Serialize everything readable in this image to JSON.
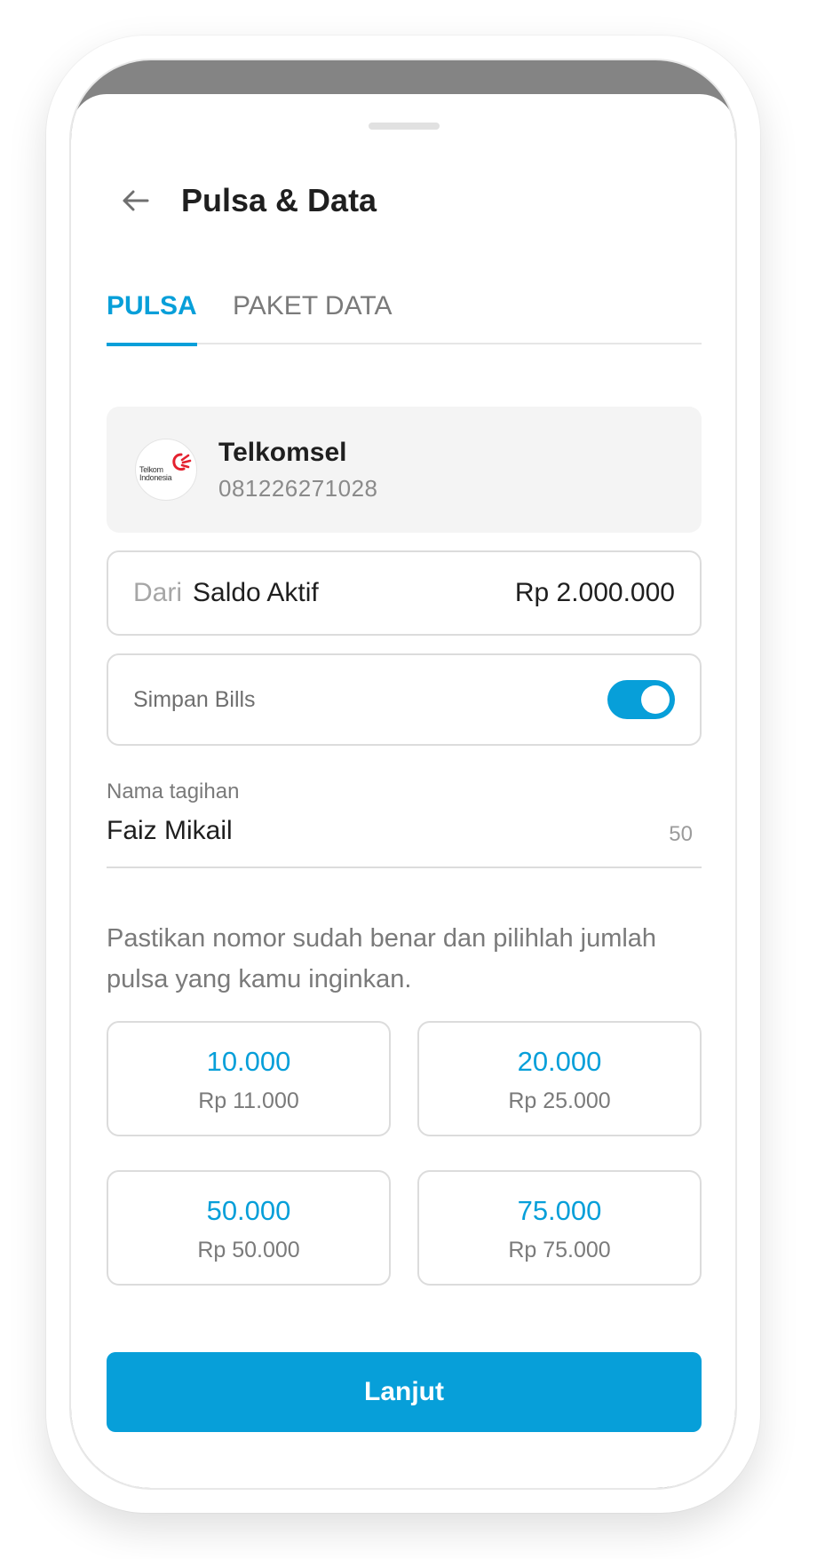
{
  "header": {
    "title": "Pulsa & Data"
  },
  "tabs": [
    {
      "label": "PULSA",
      "active": true
    },
    {
      "label": "PAKET DATA",
      "active": false
    }
  ],
  "operator": {
    "name": "Telkomsel",
    "number": "081226271028",
    "logo_text": "Telkom Indonesia"
  },
  "source": {
    "label": "Dari",
    "name": "Saldo Aktif",
    "amount": "Rp 2.000.000"
  },
  "save_bills": {
    "label": "Simpan Bills",
    "enabled": true
  },
  "bill_name": {
    "label": "Nama tagihan",
    "value": "Faiz Mikail",
    "counter": "50"
  },
  "hint": "Pastikan nomor sudah benar dan pilihlah jumlah pulsa yang kamu inginkan.",
  "nominals": [
    {
      "value": "10.000",
      "price": "Rp 11.000"
    },
    {
      "value": "20.000",
      "price": "Rp 25.000"
    },
    {
      "value": "50.000",
      "price": "Rp 50.000"
    },
    {
      "value": "75.000",
      "price": "Rp 75.000"
    }
  ],
  "actions": {
    "next_label": "Lanjut"
  },
  "colors": {
    "accent": "#079fd9",
    "text_primary": "#1f1f1f",
    "text_secondary": "#7a7a7a",
    "card_bg": "#f4f4f4",
    "border": "#dcdcdc",
    "logo_red": "#e4212f"
  }
}
